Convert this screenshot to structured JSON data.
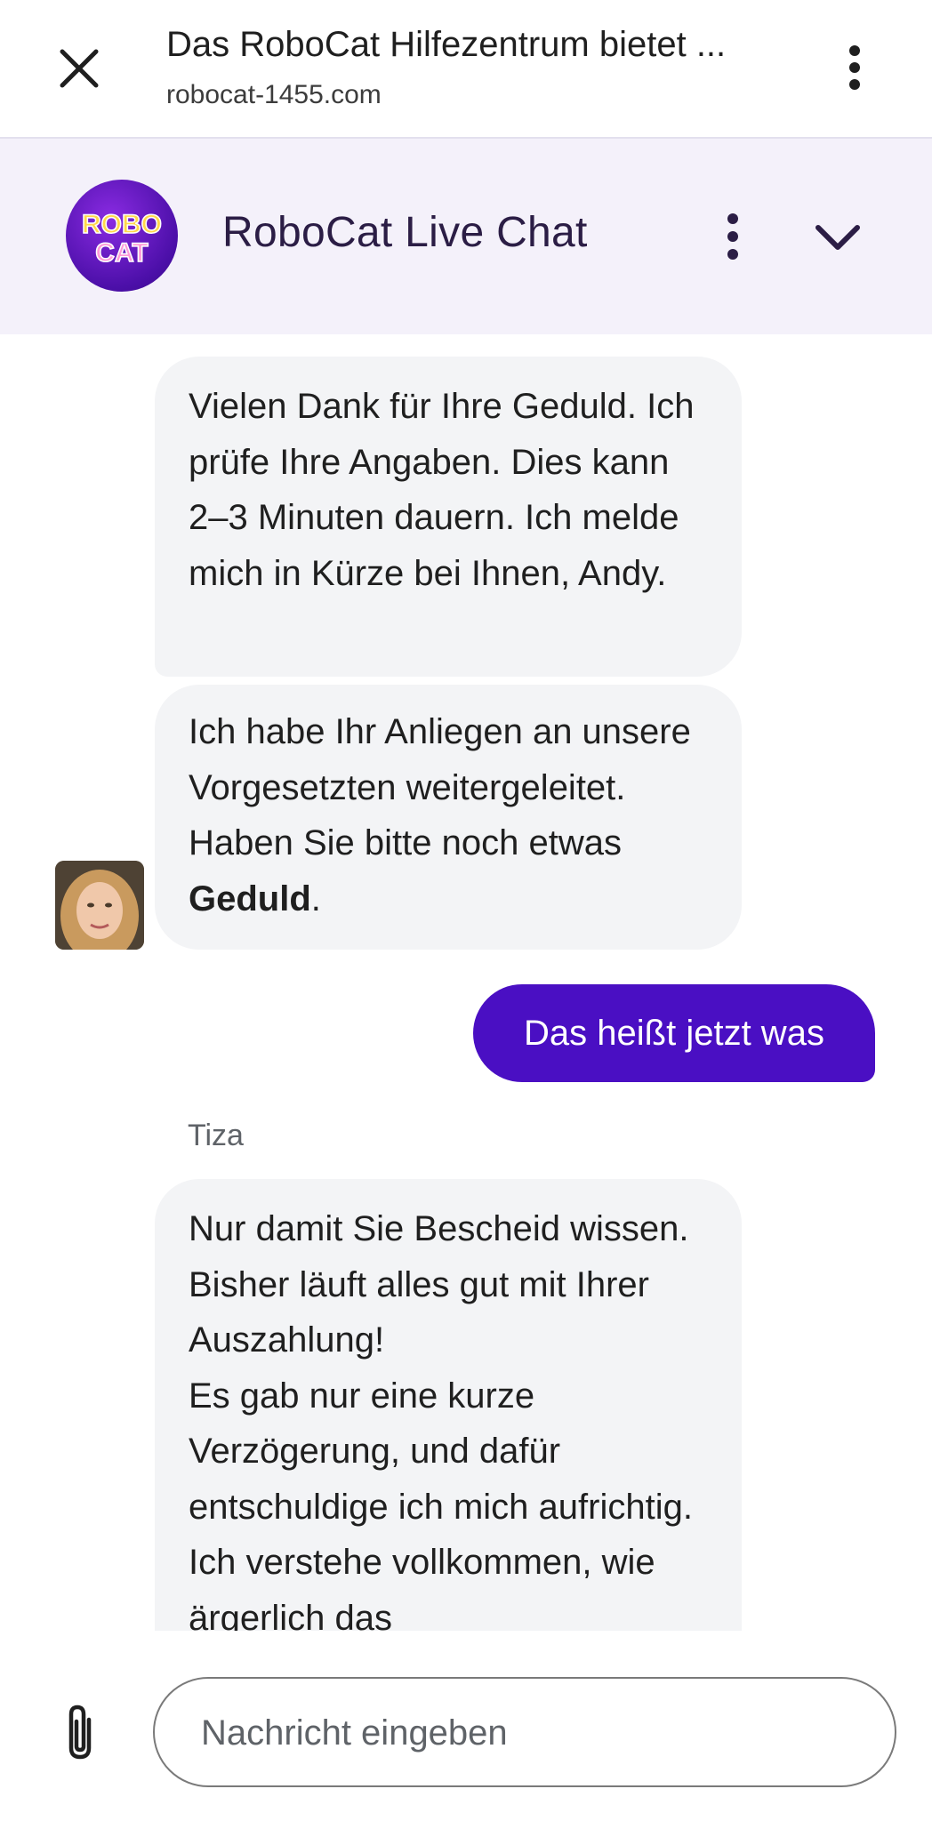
{
  "browser": {
    "title": "Das RoboCat Hilfezentrum bietet ...",
    "url": "robocat-1455.com",
    "close_icon": "close-icon",
    "more_icon": "more-vert-icon"
  },
  "chat_header": {
    "logo_text_top": "ROBO",
    "logo_text_bottom": "CAT",
    "title": "RoboCat Live Chat",
    "more_icon": "more-vert-icon",
    "collapse_icon": "chevron-down-icon"
  },
  "messages": {
    "agent_1": "Vielen Dank für Ihre Geduld. Ich prüfe Ihre Angaben. Dies kann 2–3 Minuten dauern. Ich melde mich in Kürze bei Ihnen, Andy.",
    "agent_2_prefix": "Ich habe Ihr Anliegen an unsere Vorgesetzten weitergeleitet. Haben Sie bitte noch etwas ",
    "agent_2_bold": "Geduld",
    "agent_2_suffix": ".",
    "user_1": "Das heißt jetzt was",
    "sender_name": "Tiza",
    "agent_3_line1": "Nur damit Sie Bescheid wissen. Bisher läuft alles gut mit Ihrer Auszahlung!",
    "agent_3_line2": "Es gab nur eine kurze Verzögerung, und dafür entschuldige ich mich aufrichtig. Ich verstehe vollkommen, wie ärgerlich das"
  },
  "composer": {
    "placeholder": "Nachricht eingeben",
    "attach_icon": "paperclip-icon"
  },
  "colors": {
    "header_bg": "#f4f1fa",
    "bubble_bg": "#f3f4f6",
    "sent_bubble": "#4a0fc3",
    "title_color": "#2b1d45"
  }
}
